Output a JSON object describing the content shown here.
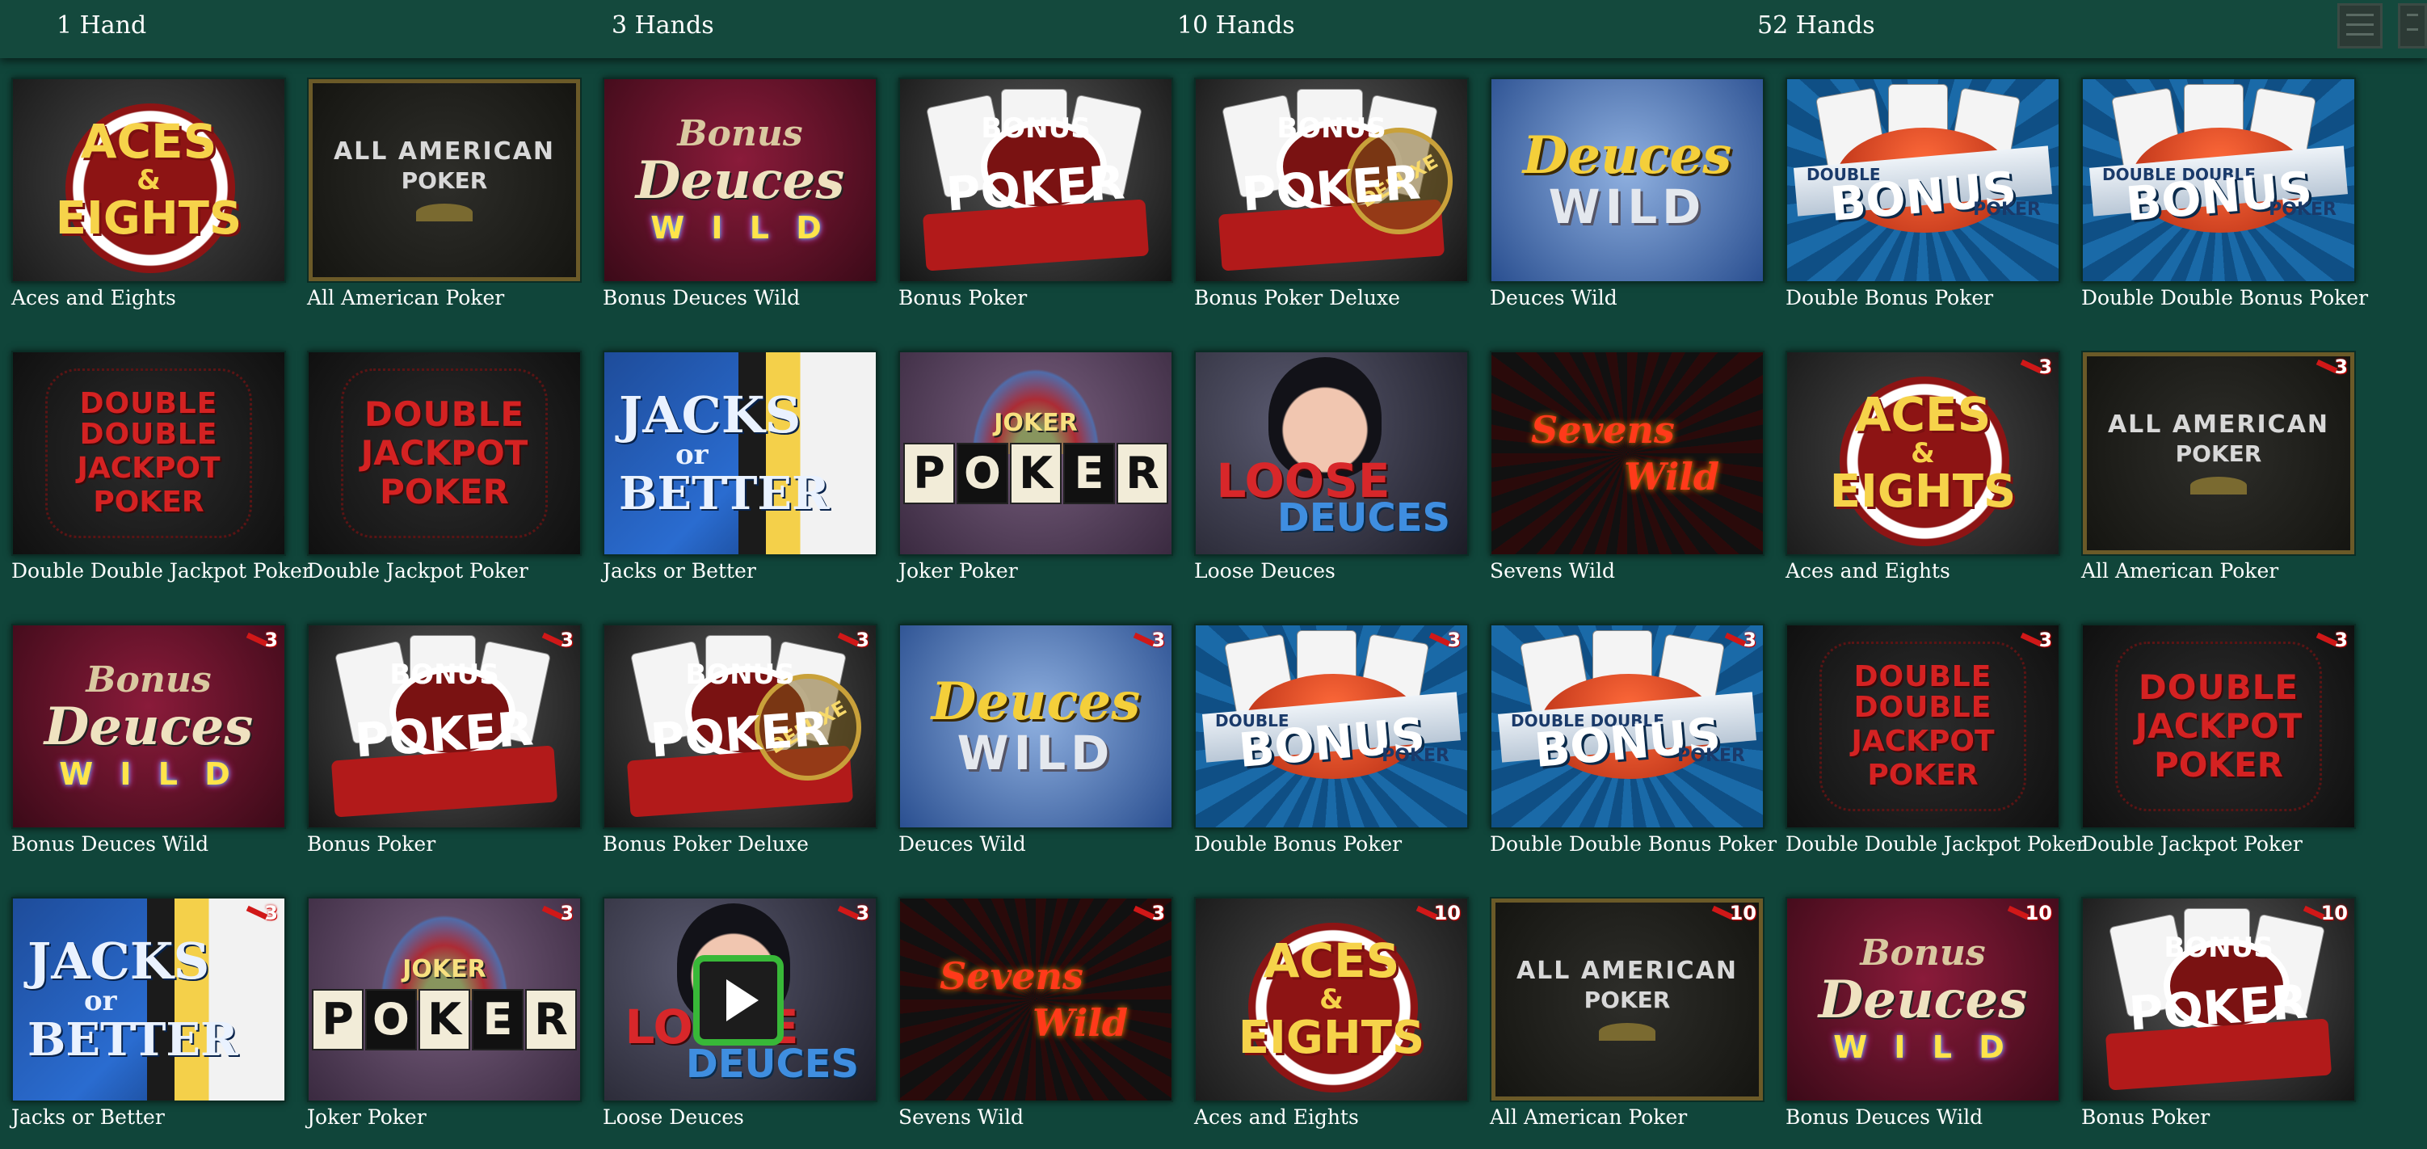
{
  "tabs": [
    "1 Hand",
    "3 Hands",
    "10 Hands",
    "52 Hands"
  ],
  "view_buttons": [
    "list-view-icon",
    "grid-view-icon"
  ],
  "games": [
    {
      "name": "Aces and Eights",
      "art": "aces",
      "badge": ""
    },
    {
      "name": "All American Poker",
      "art": "allamerican",
      "badge": ""
    },
    {
      "name": "Bonus Deuces Wild",
      "art": "bonusdeuces",
      "badge": ""
    },
    {
      "name": "Bonus Poker",
      "art": "bonuspoker",
      "badge": ""
    },
    {
      "name": "Bonus Poker Deluxe",
      "art": "bonusdeluxe",
      "badge": ""
    },
    {
      "name": "Deuces Wild",
      "art": "deuces",
      "badge": ""
    },
    {
      "name": "Double Bonus Poker",
      "art": "doublebonus",
      "badge": ""
    },
    {
      "name": "Double Double Bonus Poker",
      "art": "doubledoublebonus",
      "badge": ""
    },
    {
      "name": "Double Double Jackpot Poker",
      "art": "ddjackpot",
      "badge": ""
    },
    {
      "name": "Double Jackpot Poker",
      "art": "djackpot",
      "badge": ""
    },
    {
      "name": "Jacks or Better",
      "art": "jacks",
      "badge": ""
    },
    {
      "name": "Joker Poker",
      "art": "joker",
      "badge": ""
    },
    {
      "name": "Loose Deuces",
      "art": "loose",
      "badge": ""
    },
    {
      "name": "Sevens Wild",
      "art": "sevens",
      "badge": ""
    },
    {
      "name": "Aces and Eights",
      "art": "aces",
      "badge": "3"
    },
    {
      "name": "All American Poker",
      "art": "allamerican",
      "badge": "3"
    },
    {
      "name": "Bonus Deuces Wild",
      "art": "bonusdeuces",
      "badge": "3"
    },
    {
      "name": "Bonus Poker",
      "art": "bonuspoker",
      "badge": "3"
    },
    {
      "name": "Bonus Poker Deluxe",
      "art": "bonusdeluxe",
      "badge": "3"
    },
    {
      "name": "Deuces Wild",
      "art": "deuces",
      "badge": "3"
    },
    {
      "name": "Double Bonus Poker",
      "art": "doublebonus",
      "badge": "3"
    },
    {
      "name": "Double Double Bonus Poker",
      "art": "doubledoublebonus",
      "badge": "3"
    },
    {
      "name": "Double Double Jackpot Poker",
      "art": "ddjackpot",
      "badge": "3"
    },
    {
      "name": "Double Jackpot Poker",
      "art": "djackpot",
      "badge": "3"
    },
    {
      "name": "Jacks or Better",
      "art": "jacks",
      "badge": "3"
    },
    {
      "name": "Joker Poker",
      "art": "joker",
      "badge": "3"
    },
    {
      "name": "Loose Deuces",
      "art": "loose",
      "badge": "3",
      "play": true
    },
    {
      "name": "Sevens Wild",
      "art": "sevens",
      "badge": "3"
    },
    {
      "name": "Aces and Eights",
      "art": "aces",
      "badge": "10"
    },
    {
      "name": "All American Poker",
      "art": "allamerican",
      "badge": "10"
    },
    {
      "name": "Bonus Deuces Wild",
      "art": "bonusdeuces",
      "badge": "10"
    },
    {
      "name": "Bonus Poker",
      "art": "bonuspoker",
      "badge": "10"
    }
  ],
  "art_text": {
    "aces": [
      "ACES",
      "&",
      "EIGHTS"
    ],
    "allamerican": [
      "ALL AMERICAN",
      "POKER"
    ],
    "bonusdeuces": [
      "Bonus",
      "Deuces",
      "W I L D"
    ],
    "bonuspoker": [
      "BONUS",
      "POKER"
    ],
    "bonusdeluxe": [
      "BONUS",
      "POKER",
      "DELUXE"
    ],
    "deuces": [
      "Deuces",
      "WILD"
    ],
    "doublebonus": [
      "DOUBLE",
      "BONUS",
      "POKER"
    ],
    "doubledoublebonus": [
      "DOUBLE DOUBLE",
      "BONUS",
      "POKER"
    ],
    "ddjackpot": [
      "DOUBLE DOUBLE",
      "JACKPOT",
      "POKER"
    ],
    "djackpot": [
      "DOUBLE",
      "JACKPOT",
      "POKER"
    ],
    "jacks": [
      "JACKS",
      "or",
      "BETTER"
    ],
    "joker": [
      "JOKER",
      "POKER"
    ],
    "loose": [
      "LOOSE",
      "DEUCES"
    ],
    "sevens": [
      "Sevens",
      "Wild"
    ]
  },
  "colors": {
    "page_bg": "#10453a",
    "topbar_bg": "#14493d",
    "caption": "#ffffff",
    "badge_red": "#d01818",
    "play_green": "#38b838"
  }
}
